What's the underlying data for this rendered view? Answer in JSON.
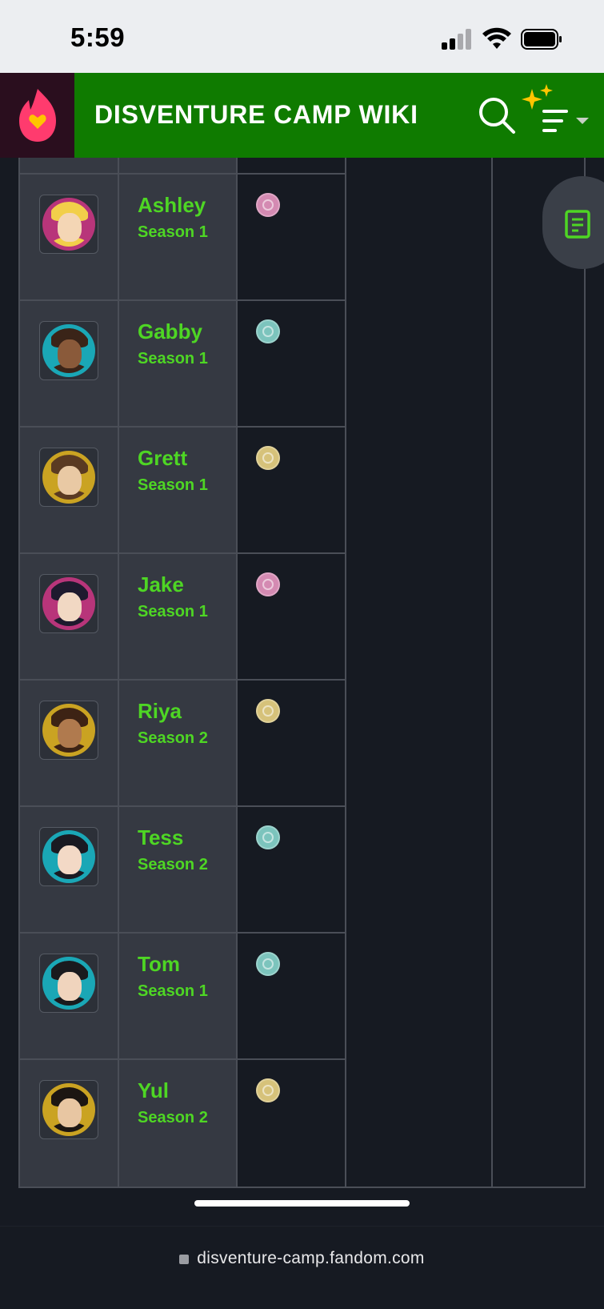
{
  "status_bar": {
    "time": "5:59"
  },
  "header": {
    "title": "DISVENTURE CAMP WIKI",
    "brand_color": "#0f7b00"
  },
  "colors": {
    "name_text": "#4ed624",
    "cell_bg": "#353942",
    "table_dark": "#161a22"
  },
  "rows": [
    {
      "name": "Ashley",
      "season": "Season 1",
      "ring": "#b8357a",
      "face": "#f4d6b5",
      "hair": "#f2cf4a",
      "badge": "#d48ab2"
    },
    {
      "name": "Gabby",
      "season": "Season 1",
      "ring": "#1aa7b6",
      "face": "#8a5a3a",
      "hair": "#3a2418",
      "badge": "#7cc4bd"
    },
    {
      "name": "Grett",
      "season": "Season 1",
      "ring": "#caa322",
      "face": "#e9c9a4",
      "hair": "#5a3a22",
      "badge": "#d6c27a"
    },
    {
      "name": "Jake",
      "season": "Season 1",
      "ring": "#b8357a",
      "face": "#f1d8c3",
      "hair": "#1e1a2e",
      "badge": "#d48ab2"
    },
    {
      "name": "Riya",
      "season": "Season 2",
      "ring": "#caa322",
      "face": "#b07a4e",
      "hair": "#3d2314",
      "badge": "#d6c27a"
    },
    {
      "name": "Tess",
      "season": "Season 2",
      "ring": "#1aa7b6",
      "face": "#f3d9c6",
      "hair": "#1a1a22",
      "badge": "#7cc4bd"
    },
    {
      "name": "Tom",
      "season": "Season 1",
      "ring": "#1aa7b6",
      "face": "#f0d4bd",
      "hair": "#1a1a1e",
      "badge": "#7cc4bd"
    },
    {
      "name": "Yul",
      "season": "Season 2",
      "ring": "#caa322",
      "face": "#e8c6a2",
      "hair": "#1c1612",
      "badge": "#d6c27a"
    }
  ],
  "url_bar": {
    "url": "disventure-camp.fandom.com"
  },
  "icons": {
    "logo": "fandom-heart-flame-icon",
    "search": "search-icon",
    "menu": "ai-sparkle-menu-icon",
    "toc": "table-of-contents-icon",
    "lock": "lock-icon"
  }
}
